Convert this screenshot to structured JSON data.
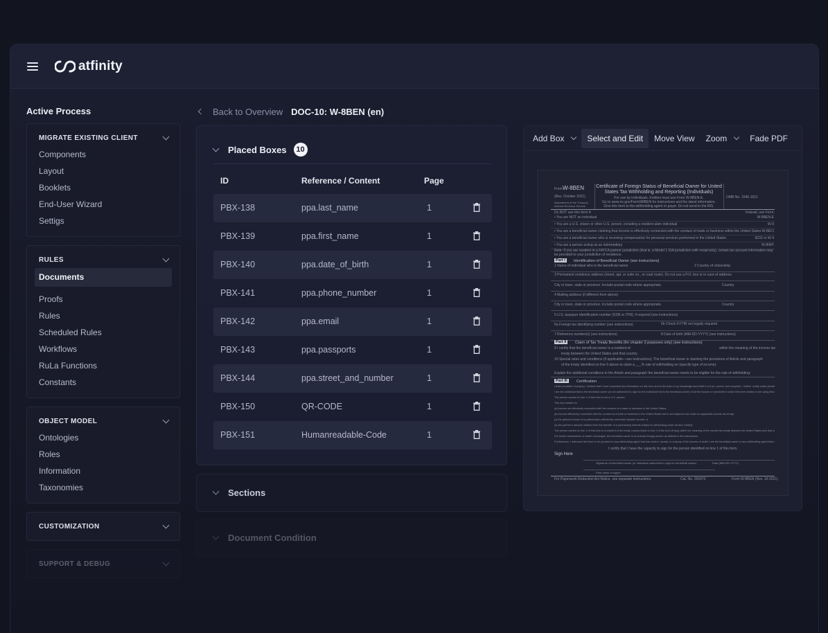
{
  "app": {
    "logo_text": "atfinity"
  },
  "sidebar": {
    "title": "Active Process",
    "groups": [
      {
        "title": "MIGRATE EXISTING CLIENT",
        "items": [
          "Components",
          "Layout",
          "Booklets",
          "End-User Wizard",
          "Settigs"
        ]
      },
      {
        "title": "RULES",
        "active": "Documents",
        "items": [
          "Proofs",
          "Rules",
          "Scheduled Rules",
          "Workflows",
          "RuLa Functions",
          "Constants"
        ]
      },
      {
        "title": "OBJECT MODEL",
        "items": [
          "Ontologies",
          "Roles",
          "Information",
          "Taxonomies"
        ]
      },
      {
        "title": "CUSTOMIZATION"
      },
      {
        "title": "SUPPORT & DEBUG"
      }
    ]
  },
  "breadcrumb": {
    "back": "Back to Overview",
    "current": "DOC-10: W-8BEN (en)"
  },
  "placed_boxes": {
    "title": "Placed Boxes",
    "count": "10",
    "headers": {
      "id": "ID",
      "ref": "Reference / Content",
      "page": "Page"
    },
    "rows": [
      {
        "id": "PBX-138",
        "ref": "ppa.last_name",
        "page": "1"
      },
      {
        "id": "PBX-139",
        "ref": "ppa.first_name",
        "page": "1"
      },
      {
        "id": "PBX-140",
        "ref": "ppa.date_of_birth",
        "page": "1"
      },
      {
        "id": "PBX-141",
        "ref": "ppa.phone_number",
        "page": "1"
      },
      {
        "id": "PBX-142",
        "ref": "ppa.email",
        "page": "1"
      },
      {
        "id": "PBX-143",
        "ref": "ppa.passports",
        "page": "1"
      },
      {
        "id": "PBX-144",
        "ref": "ppa.street_and_number",
        "page": "1"
      },
      {
        "id": "PBX-150",
        "ref": "QR-CODE",
        "page": "1"
      },
      {
        "id": "PBX-151",
        "ref": "Humanreadable-Code",
        "page": "1"
      }
    ]
  },
  "sections": {
    "title": "Sections"
  },
  "document_condition": {
    "title": "Document Condition"
  },
  "toolbar": {
    "add_box": "Add Box",
    "select_edit": "Select and Edit",
    "move_view": "Move View",
    "zoom": "Zoom",
    "fade_pdf": "Fade PDF"
  },
  "pdf": {
    "form_label": "Form",
    "form_name": "W-8BEN",
    "rev": "(Rev. October 2021)",
    "dept": "Department of the Treasury Internal Revenue Service",
    "title_1": "Certificate of Foreign Status of Beneficial Owner for United",
    "title_2": "States Tax Withholding and Reporting (Individuals)",
    "sub_1": "For use by individuals. Entities must use Form W-8BEN-E.",
    "sub_2": "Go to www.irs.gov/FormW8BEN for instructions and the latest information.",
    "sub_3": "Give this form to the withholding agent or payer. Do not send to the IRS.",
    "omb": "OMB No. 1545-1621",
    "do_not": "Do NOT use this form if:",
    "instead": "Instead, use Form:",
    "lines": [
      "• You are NOT an individual",
      "• You are a U.S. citizen or other U.S. person, including a resident alien individual",
      "• You are a beneficial owner claiming that income is effectively connected with the conduct of trade or business within the United States",
      "• You are a beneficial owner who is receiving compensation for personal services performed in the United States",
      "• You are a person acting as an intermediary"
    ],
    "right_forms": [
      "W-8BEN-E",
      "W-9",
      "W-8ECI",
      "8233 or W-4",
      "W-8IMY"
    ],
    "note": "Note: If you are resident in a FATCA partner jurisdiction (that is, a Model 1 IGA jurisdiction with reciprocity), certain tax account information may be provided to your jurisdiction of residence.",
    "part1": "Part I",
    "part1_title": "Identification of Beneficial Owner (see instructions)",
    "p1_fields": [
      "1   Name of individual who is the beneficial owner",
      "3   Permanent residence address (street, apt. or suite no., or rural route). Do not use a P.O. box or in-care-of address.",
      "City or town, state or province. Include postal code where appropriate.",
      "4   Mailing address (if different from above)",
      "City or town, state or province. Include postal code where appropriate.",
      "5   U.S. taxpayer identification number (SSN or ITIN), if required (see instructions)",
      "6a   Foreign tax identifying number (see instructions)",
      "7   Reference number(s) (see instructions)"
    ],
    "country_label": "2   Country of citizenship",
    "country": "Country",
    "field_6b": "6b  Check if FTIN not legally required",
    "field_8": "8   Date of birth (MM-DD-YYYY) (see instructions)",
    "part2": "Part II",
    "part2_title": "Claim of Tax Treaty Benefits (for chapter 3 purposes only) (see instructions)",
    "p2_lines": [
      "9   I certify that the beneficial owner is a resident of",
      "treaty between the United States and that country.",
      "10   Special rates and conditions (if applicable—see instructions): The beneficial owner is claiming the provisions of Article and paragraph",
      "of the treaty identified on line 9 above to claim a ___% rate of withholding on (specify type of income):",
      "Explain the additional conditions in the Article and paragraph the beneficial owner meets to be eligible for the rate of withholding:"
    ],
    "p2_right": "within the meaning of the income tax",
    "part3": "Part III",
    "part3_title": "Certification",
    "p3_lines": [
      "Under penalties of perjury, I declare that I have examined the information on this form and to the best of my knowledge and belief it is true, correct, and complete. I further certify under penalties of perjury that:",
      "I am the individual that is the beneficial owner (or am authorized to sign for the individual that is the beneficial owner) of all the income or proceeds to which this form relates or am using this form to document myself for chapter 4 purposes;",
      "The person named on line 1 of this form is not a U.S. person;",
      "This form relates to:",
      "(a) income not effectively connected with the conduct of a trade or business in the United States;",
      "(b) income effectively connected with the conduct of a trade or business in the United States but is not subject to tax under an applicable income tax treaty;",
      "(c) the partner's share of a partnership's effectively connected taxable income; or",
      "(d) the partner's amount realized from the transfer of a partnership interest subject to withholding under section 1446(f);",
      "The person named on line 1 of this form is a resident of the treaty country listed on line 9 of the form (if any) within the meaning of the income tax treaty between the United States and that country; and",
      "For broker transactions or barter exchanges, the beneficial owner is an exempt foreign person as defined in the instructions.",
      "Furthermore, I authorize this form to be provided to any withholding agent that has control, receipt, or custody of the income of which I am the beneficial owner or any withholding agent that can disburse or make payments of the income of which I am the beneficial owner. I agree that I will submit a new form within 30 days if any certification made on this form becomes incorrect."
    ],
    "certify_box": "I certify that I have the capacity to sign for the person identified on line 1 of this form.",
    "sign_here": "Sign Here",
    "sig_label": "Signature of beneficial owner (or individual authorized to sign for beneficial owner)",
    "date_label": "Date (MM-DD-YYYY)",
    "print_name": "Print name of signer",
    "footer_left": "For Paperwork Reduction Act Notice, see separate instructions.",
    "cat_no": "Cat. No. 25047Z",
    "footer_right": "Form W-8BEN (Rev. 10-2021)"
  }
}
